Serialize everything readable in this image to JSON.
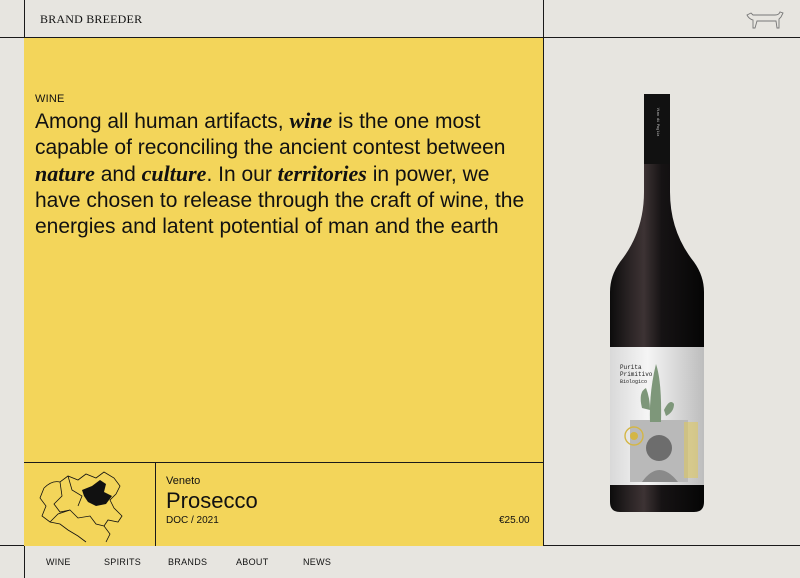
{
  "header": {
    "brand": "BRAND BREEDER",
    "logo_icon": "dog-icon"
  },
  "intro": {
    "section_label": "WINE",
    "text_parts": [
      "Among all human artifacts, ",
      "wine",
      " is the one most capable of reconciling the ancient contest between ",
      "nature",
      " and ",
      "culture",
      ". In our ",
      "territories",
      " in power, we have chosen to release through the craft of wine, the energies and latent potential of man and the earth"
    ]
  },
  "product": {
    "region": "Veneto",
    "name": "Prosecco",
    "doc": "DOC / 2021",
    "price": "€25.00",
    "map_icon": "italy-map-icon",
    "bottle_label": [
      "Purita",
      "Primitivo",
      "Biologico"
    ]
  },
  "nav": {
    "items": [
      "WINE",
      "SPIRITS",
      "BRANDS",
      "ABOUT",
      "NEWS"
    ]
  },
  "colors": {
    "background": "#e7e5e0",
    "accent_yellow": "#f3d55a",
    "line": "#1a1a1a"
  }
}
